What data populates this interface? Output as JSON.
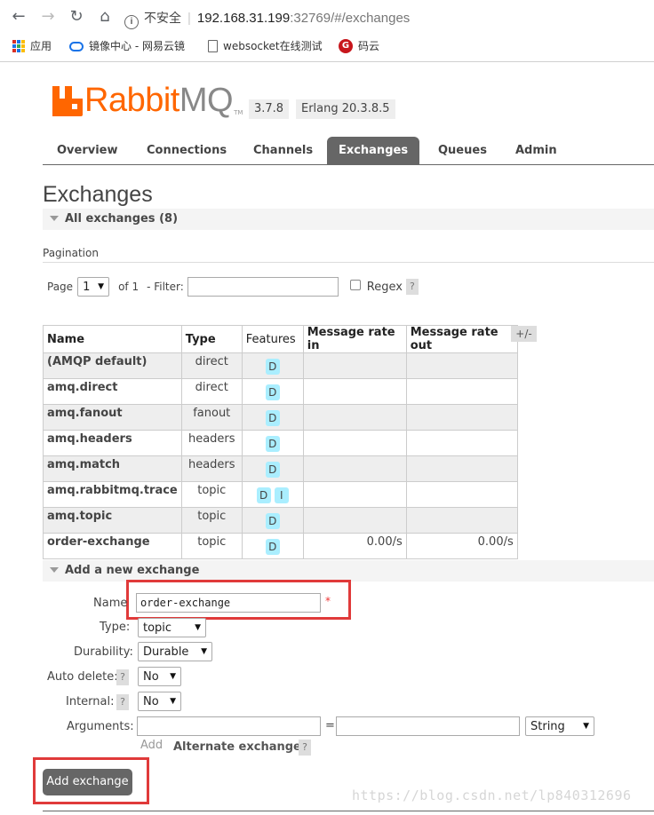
{
  "browser": {
    "address_insecure": "不安全",
    "address_separator": "|",
    "address_host": "192.168.31.199",
    "address_path": ":32769/#/exchanges",
    "bookmarks": [
      {
        "label": "应用",
        "icon": "apps-grid-icon"
      },
      {
        "label": "镜像中心 - 网易云镜",
        "icon": "cloud-icon"
      },
      {
        "label": "websocket在线测试",
        "icon": "page-icon"
      },
      {
        "label": "码云",
        "icon": "gitee-icon"
      }
    ]
  },
  "header": {
    "logo_rabbit": "Rabbit",
    "logo_mq": "MQ",
    "logo_tm": "TM",
    "version": "3.7.8",
    "erlang": "Erlang 20.3.8.5"
  },
  "tabs": [
    "Overview",
    "Connections",
    "Channels",
    "Exchanges",
    "Queues",
    "Admin"
  ],
  "active_tab": "Exchanges",
  "page_title": "Exchanges",
  "all_exchanges": {
    "title": "All exchanges (8)",
    "pagination_label": "Pagination",
    "page_label": "Page",
    "page_value": "1",
    "of_label": "of 1",
    "filter_label": "- Filter:",
    "filter_value": "",
    "regex_label": "Regex",
    "help": "?"
  },
  "table": {
    "columns": [
      "Name",
      "Type",
      "Features",
      "Message rate in",
      "Message rate out"
    ],
    "toggle": "+/-",
    "rows": [
      {
        "name": "(AMQP default)",
        "type": "direct",
        "features": [
          "D"
        ],
        "rate_in": "",
        "rate_out": ""
      },
      {
        "name": "amq.direct",
        "type": "direct",
        "features": [
          "D"
        ],
        "rate_in": "",
        "rate_out": ""
      },
      {
        "name": "amq.fanout",
        "type": "fanout",
        "features": [
          "D"
        ],
        "rate_in": "",
        "rate_out": ""
      },
      {
        "name": "amq.headers",
        "type": "headers",
        "features": [
          "D"
        ],
        "rate_in": "",
        "rate_out": ""
      },
      {
        "name": "amq.match",
        "type": "headers",
        "features": [
          "D"
        ],
        "rate_in": "",
        "rate_out": ""
      },
      {
        "name": "amq.rabbitmq.trace",
        "type": "topic",
        "features": [
          "D",
          "I"
        ],
        "rate_in": "",
        "rate_out": ""
      },
      {
        "name": "amq.topic",
        "type": "topic",
        "features": [
          "D"
        ],
        "rate_in": "",
        "rate_out": ""
      },
      {
        "name": "order-exchange",
        "type": "topic",
        "features": [
          "D"
        ],
        "rate_in": "0.00/s",
        "rate_out": "0.00/s"
      }
    ]
  },
  "add_form": {
    "title": "Add a new exchange",
    "name_label": "Name",
    "name_value": "order-exchange",
    "required_mark": "*",
    "type_label": "Type:",
    "type_value": "topic",
    "durability_label": "Durability:",
    "durability_value": "Durable",
    "auto_delete_label": "Auto delete:",
    "auto_delete_value": "No",
    "internal_label": "Internal:",
    "internal_value": "No",
    "arguments_label": "Arguments:",
    "arg_equals": "=",
    "arg_type_value": "String",
    "add_link": "Add",
    "alternate_exchange": "Alternate exchange",
    "help": "?",
    "submit_label": "Add exchange"
  },
  "watermark": "https://blog.csdn.net/lp840312696",
  "colors": {
    "accent_orange": "#ff6600",
    "highlight_red": "#e03a3a",
    "badge_blue": "#aaeeff"
  }
}
